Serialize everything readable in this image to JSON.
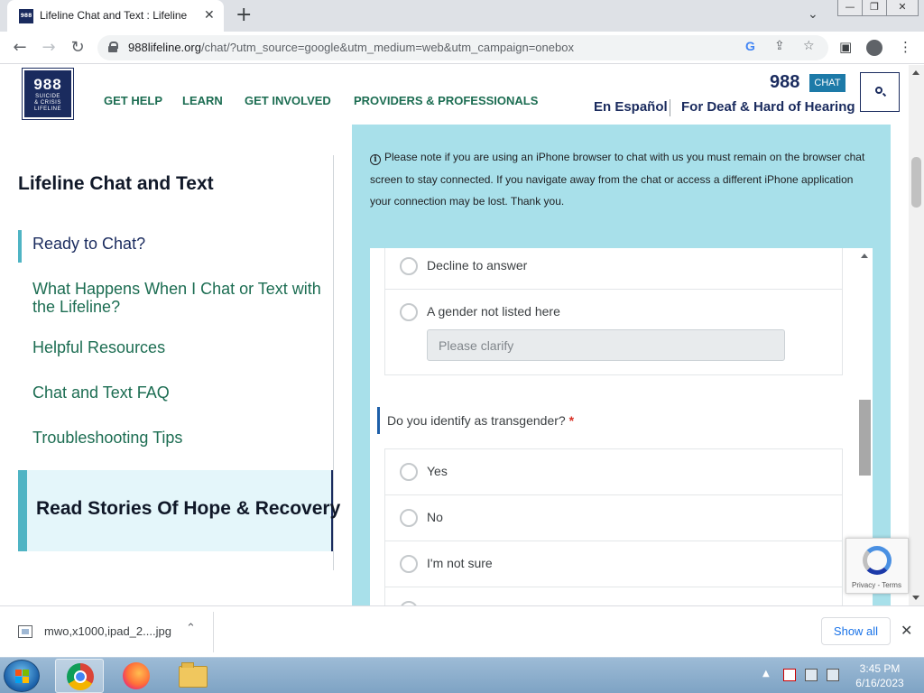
{
  "browser": {
    "tab_title": "Lifeline Chat and Text : Lifeline",
    "tab_favicon_text": "988",
    "tab_close_glyph": "✕",
    "new_tab_glyph": "+",
    "url_host": "988lifeline.org",
    "url_path": "/chat/?utm_source=google&utm_medium=web&utm_campaign=onebox",
    "window_buttons": [
      "—",
      "❐",
      "✕"
    ]
  },
  "header": {
    "logo": {
      "number": "988",
      "line1": "SUICIDE",
      "line2": "& CRISIS",
      "line3": "LIFELINE"
    },
    "nav": [
      "GET HELP",
      "LEARN",
      "GET INVOLVED",
      "PROVIDERS & PROFESSIONALS"
    ],
    "brand": "988",
    "chat_badge": "CHAT",
    "lang_link": "En Español",
    "deaf_link": "For Deaf & Hard of Hearing"
  },
  "sidebar": {
    "title": "Lifeline Chat and Text",
    "items": [
      {
        "label": "Ready to Chat?",
        "active": true
      },
      {
        "label": "What Happens When I Chat or Text with the Lifeline?"
      },
      {
        "label": "Helpful Resources"
      },
      {
        "label": "Chat and Text FAQ"
      },
      {
        "label": "Troubleshooting Tips"
      }
    ],
    "stories": "Read Stories Of Hope & Recovery"
  },
  "chat": {
    "notice": "Please note if you are using an iPhone browser to chat with us you must remain on the browser chat screen to stay connected. If you navigate away from the chat or access a different iPhone application your connection may be lost. Thank you.",
    "gender_options": [
      "Decline to answer",
      "A gender not listed here"
    ],
    "clarify_placeholder": "Please clarify",
    "question": "Do you identify as transgender?",
    "required_mark": "*",
    "trans_options": [
      "Yes",
      "No",
      "I'm not sure"
    ]
  },
  "recaptcha": {
    "text": "Privacy - Terms"
  },
  "download": {
    "filename": "mwo,x1000,ipad_2....jpg",
    "show_all": "Show all"
  },
  "taskbar": {
    "time": "3:45 PM",
    "date": "6/16/2023"
  },
  "colors": {
    "nav_green": "#1c6d52",
    "navy": "#1a2b5e",
    "chat_panel": "#a8e0ea",
    "accent_teal": "#4fb4c4"
  }
}
